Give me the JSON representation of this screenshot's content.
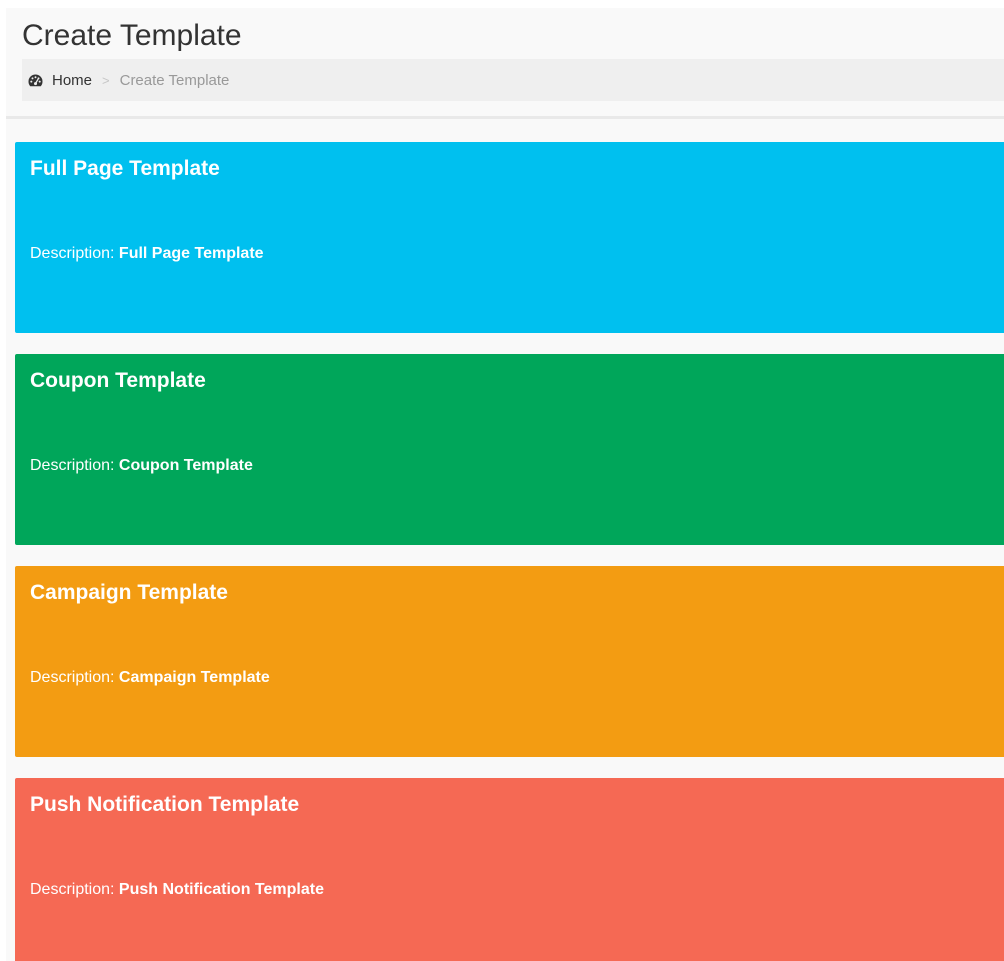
{
  "header": {
    "title": "Create Template"
  },
  "breadcrumb": {
    "home_icon": "dashboard-gauge-icon",
    "home_label": "Home",
    "separator": ">",
    "current": "Create Template"
  },
  "templates": [
    {
      "title": "Full Page Template",
      "description_label": "Description: ",
      "description_value": "Full Page Template",
      "color": "#00c0ef"
    },
    {
      "title": "Coupon Template",
      "description_label": "Description: ",
      "description_value": "Coupon Template",
      "color": "#00a65a"
    },
    {
      "title": "Campaign Template",
      "description_label": "Description: ",
      "description_value": "Campaign Template",
      "color": "#f39c12"
    },
    {
      "title": "Push Notification Template",
      "description_label": "Description: ",
      "description_value": "Push Notification Template",
      "color": "#f56954"
    }
  ]
}
